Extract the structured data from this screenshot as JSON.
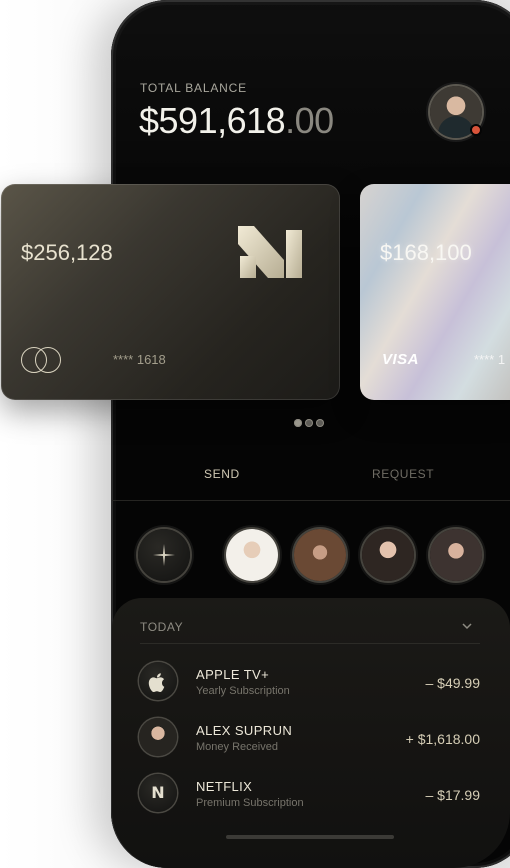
{
  "header": {
    "balance_label": "TOTAL BALANCE",
    "balance_main": "$591,618",
    "balance_cents": ".00"
  },
  "cards": [
    {
      "amount": "$256,128",
      "number": "**** 1618",
      "brand": "mastercard-icon"
    },
    {
      "amount": "$168,100",
      "number": "**** 1",
      "brand": "VISA"
    }
  ],
  "carousel": {
    "count": 3,
    "active": 0
  },
  "tabs": {
    "send": "SEND",
    "request": "REQUEST"
  },
  "contacts": [
    "add-contact",
    "contact-1",
    "contact-2",
    "contact-3",
    "contact-4"
  ],
  "transactions": {
    "section_label": "TODAY",
    "items": [
      {
        "icon": "apple-icon",
        "title": "APPLE TV+",
        "subtitle": "Yearly Subscription",
        "amount": "– $49.99"
      },
      {
        "icon": "avatar",
        "title": "ALEX SUPRUN",
        "subtitle": "Money Received",
        "amount": "+ $1,618.00"
      },
      {
        "icon": "netflix-icon",
        "glyph": "N",
        "title": "NETFLIX",
        "subtitle": "Premium Subscription",
        "amount": "– $17.99"
      }
    ]
  },
  "colors": {
    "accent": "#d6ceb6",
    "background": "#050505",
    "alert_dot": "#d9543a"
  }
}
